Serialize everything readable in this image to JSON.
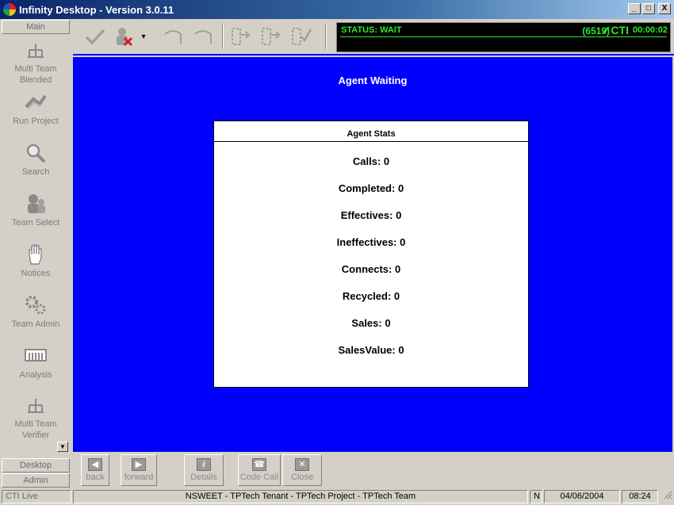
{
  "window": {
    "title": "Infinity Desktop - Version 3.0.11",
    "min_label": "_",
    "max_label": "□",
    "close_label": "X"
  },
  "sidebar": {
    "header": "Main",
    "items": [
      {
        "label": "Multi Team Blended",
        "icon": "network-icon"
      },
      {
        "label": "Run Project",
        "icon": "run-icon"
      },
      {
        "label": "Search",
        "icon": "search-icon"
      },
      {
        "label": "Team Select",
        "icon": "team-icon"
      },
      {
        "label": "Notices",
        "icon": "hand-icon"
      },
      {
        "label": "Team Admin",
        "icon": "gears-icon"
      },
      {
        "label": "Analysis",
        "icon": "chart-icon"
      },
      {
        "label": "Multi Team Verifier",
        "icon": "network-icon"
      }
    ],
    "bottom_tabs": [
      "Desktop",
      "Admin"
    ]
  },
  "toolbar": {
    "status_text": "STATUS: WAIT",
    "extension": "(6519)",
    "cti_label": "✓CTI",
    "timer": "00:00:02"
  },
  "main": {
    "title": "Agent Waiting",
    "stats_header": "Agent Stats",
    "stats": [
      "Calls: 0",
      "Completed: 0",
      "Effectives: 0",
      "Ineffectives: 0",
      "Connects: 0",
      "Recycled: 0",
      "Sales: 0",
      "SalesValue: 0"
    ]
  },
  "bottombar": {
    "back": "back",
    "forward": "forward",
    "details": "Details",
    "code_call": "Code Call",
    "close": "Close"
  },
  "statusbar": {
    "cti": "CTI Live",
    "context": "NSWEET - TPTech Tenant - TPTech Project - TPTech Team",
    "mode": "N",
    "date": "04/06/2004",
    "time": "08:24"
  }
}
